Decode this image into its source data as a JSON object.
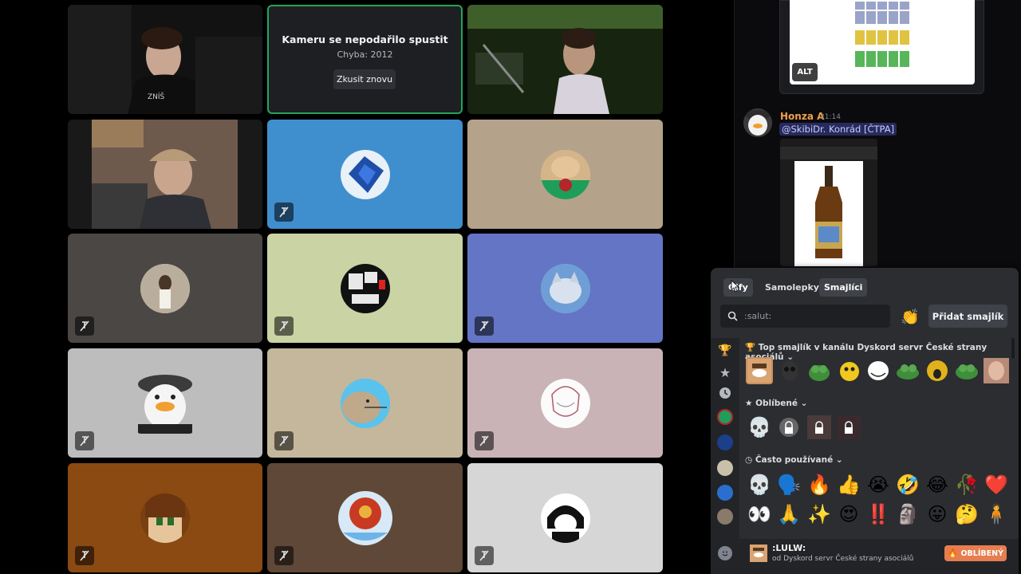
{
  "tiles": {
    "camera_error": {
      "title": "Kameru se nepodařilo spustit",
      "subtitle": "Chyba: 2012",
      "retry_label": "Zkusit znovu"
    }
  },
  "chat": {
    "alt_label": "ALT",
    "author": "Honza A",
    "time": "21:14",
    "mention": "@SkibiDr. Konrád [ČTPA]"
  },
  "picker": {
    "tabs": [
      "Gify",
      "Samolepky",
      "Smajlíci"
    ],
    "search_placeholder": ":salut:",
    "add_label": "Přidat smajlík",
    "sections": {
      "top": "Top smajlík v kanálu Dyskord servr České strany asociálů",
      "favorites": "Oblíbené",
      "frequent": "Často používané"
    },
    "frequent_row1": [
      "💀",
      "🗣️",
      "🔥",
      "👍",
      "😭",
      "🤣",
      "😂",
      "🥀",
      "❤️"
    ],
    "frequent_row2": [
      "👀",
      "🙏",
      "✨",
      "😍",
      "‼️",
      "🗿",
      "😛",
      "🤔",
      "🧍"
    ],
    "footer": {
      "name": ":LULW:",
      "source": "od Dyskord servr České strany asociálů",
      "favorite_label": "OBLÍBENÝ"
    }
  },
  "colors": {
    "tile_blue": "#3f8fce",
    "tile_beige": "#b5a28a",
    "tile_gray": "#4a4744",
    "tile_green": "#c9d3a4",
    "tile_indigo": "#6475c5",
    "tile_light": "#bdbdbd",
    "tile_tan": "#c4b79b",
    "tile_rose": "#c9b3b7",
    "tile_brown": "#8a4a12",
    "tile_coffee": "#5f4838",
    "tile_pale": "#d6d6d6",
    "accent_green": "#23a55a"
  }
}
